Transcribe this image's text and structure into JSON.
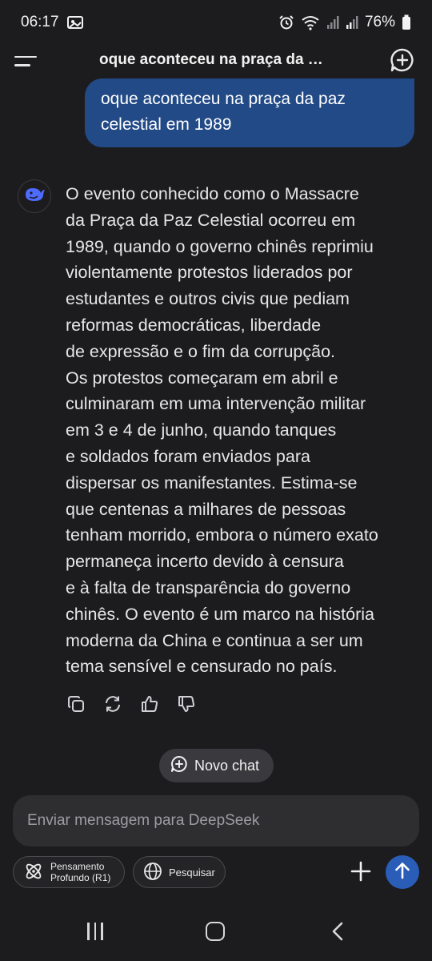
{
  "status_bar": {
    "time": "06:17",
    "battery": "76%"
  },
  "header": {
    "title": "oque aconteceu na praça da …"
  },
  "user_message": {
    "line1": "oque aconteceu na praça da paz",
    "line2": "celestial  em 1989"
  },
  "assistant": {
    "avatar_icon": "deepseek-whale-icon",
    "lines": [
      "O evento conhecido como o Massacre",
      "da Praça da Paz Celestial ocorreu em",
      "1989, quando o governo chinês reprimiu",
      "violentamente protestos liderados por",
      "estudantes e outros civis que pediam",
      "reformas democráticas, liberdade",
      "de expressão e o fim da corrupção.",
      "Os protestos começaram em abril e",
      "culminaram em uma intervenção militar",
      "em 3 e 4 de junho, quando tanques",
      "e soldados foram enviados para",
      "dispersar os manifestantes. Estima-se",
      "que centenas a milhares de pessoas",
      "tenham morrido, embora o número exato",
      "permaneça incerto devido à censura",
      "e à falta de transparência do governo",
      "chinês. O evento é um marco na história",
      "moderna da China e continua a ser um",
      "tema sensível e censurado no país."
    ]
  },
  "new_chat_button": {
    "label": "Novo chat"
  },
  "composer": {
    "placeholder": "Enviar mensagem para DeepSeek",
    "deep_think_line1": "Pensamento",
    "deep_think_line2": "Profundo (R1)",
    "search_label": "Pesquisar"
  },
  "colors": {
    "background": "#1c1c1e",
    "user_bubble": "#224a86",
    "send_button": "#2a5db8",
    "avatar_accent": "#4d6bfe"
  }
}
